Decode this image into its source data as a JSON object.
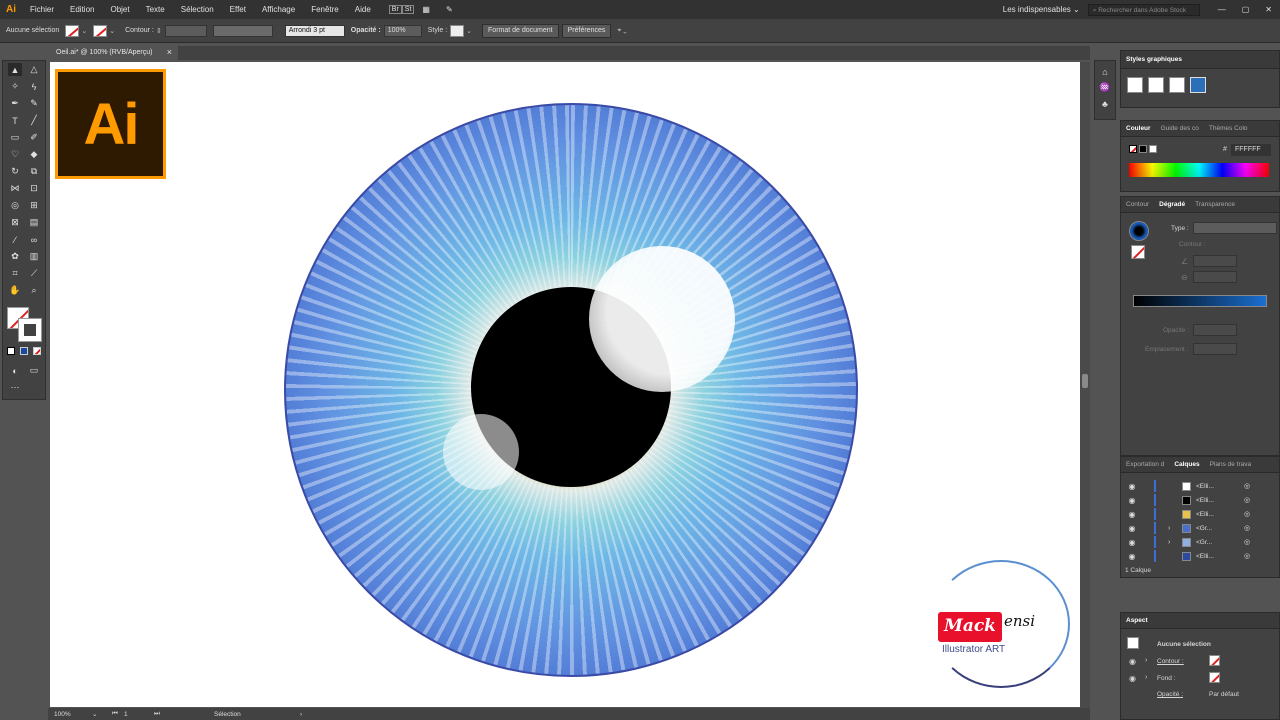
{
  "menu": {
    "logo": "Ai",
    "items": [
      "Fichier",
      "Edition",
      "Objet",
      "Texte",
      "Sélection",
      "Effet",
      "Affichage",
      "Fenêtre",
      "Aide"
    ],
    "workspace": "Les indispensables",
    "search_placeholder": "Rechercher dans Adobe Stock"
  },
  "control": {
    "selection": "Aucune sélection",
    "stroke_label": "Contour :",
    "brush": "Arrondi 3 pt",
    "opacity_label": "Opacité :",
    "opacity_value": "100%",
    "style_label": "Style :",
    "doc_format_btn": "Format de document",
    "prefs_btn": "Préférences"
  },
  "document": {
    "tab_title": "Oeil.ai* @ 100% (RVB/Aperçu)",
    "close": "×"
  },
  "artwork": {
    "logo_text": "Ai",
    "brand_left": "Mack",
    "brand_right": "ensi",
    "brand_subtitle": "Illustrator ART"
  },
  "status": {
    "zoom": "100%",
    "artboard": "1",
    "tool": "Sélection"
  },
  "panels": {
    "styles_title": "Styles graphiques",
    "color_tabs": [
      "Couleur",
      "Guide des co",
      "Thèmes Colo"
    ],
    "hex_prefix": "#",
    "hex_value": "FFFFFF",
    "gradient_tabs": [
      "Contour",
      "Dégradé",
      "Transparence"
    ],
    "gradient_type_label": "Type :",
    "gradient_stroke_label": "Contour :",
    "gradient_opacity_label": "Opacité :",
    "gradient_location_label": "Emplacement :",
    "layers_tabs": [
      "Exportation d",
      "Calques",
      "Plans de trava"
    ],
    "layers": [
      {
        "name": "<Elli...",
        "thumb": "#ffffff",
        "expand": ""
      },
      {
        "name": "<Elli...",
        "thumb": "#000000",
        "expand": ""
      },
      {
        "name": "<Elli...",
        "thumb": "#e8c24a",
        "expand": ""
      },
      {
        "name": "<Gr...",
        "thumb": "#4a6fc8",
        "expand": "›"
      },
      {
        "name": "<Gr...",
        "thumb": "#8fb0e0",
        "expand": "›"
      },
      {
        "name": "<Elli...",
        "thumb": "#2a4aa0",
        "expand": ""
      }
    ],
    "layers_count": "1 Calque",
    "aspect_title": "Aspect",
    "aspect_selection": "Aucune sélection",
    "aspect_contour": "Contour :",
    "aspect_fond": "Fond :",
    "aspect_opacity": "Opacité :",
    "aspect_opacity_value": "Par défaut"
  },
  "colors": {
    "accent": "#ff9a00",
    "iris_outer": "#2a3f9e",
    "iris_mid": "#6fb8e6",
    "brand_red": "#e8102a"
  }
}
